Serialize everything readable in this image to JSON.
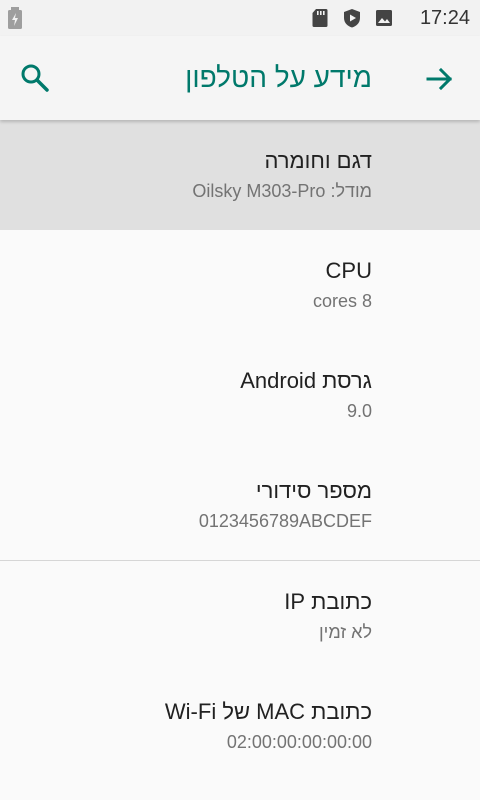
{
  "status_bar": {
    "time": "17:24",
    "icons": [
      "battery-charging-icon",
      "sd-card-icon",
      "play-protect-icon",
      "image-icon"
    ]
  },
  "app_bar": {
    "title": "מידע על הטלפון",
    "back_icon": "arrow-icon",
    "search_icon": "search-icon",
    "accent_color": "#00796b"
  },
  "items": [
    {
      "title": "דגם וחומרה",
      "summary": "מודל: Oilsky M303-Pro"
    },
    {
      "title": "CPU",
      "summary": "8 cores"
    },
    {
      "title": "גרסת Android",
      "summary": "9.0"
    },
    {
      "title": "מספר סידורי",
      "summary": "0123456789ABCDEF"
    },
    {
      "title": "כתובת IP",
      "summary": "לא זמין"
    },
    {
      "title": "כתובת MAC של Wi-Fi",
      "summary": "02:00:00:00:00:00"
    }
  ]
}
